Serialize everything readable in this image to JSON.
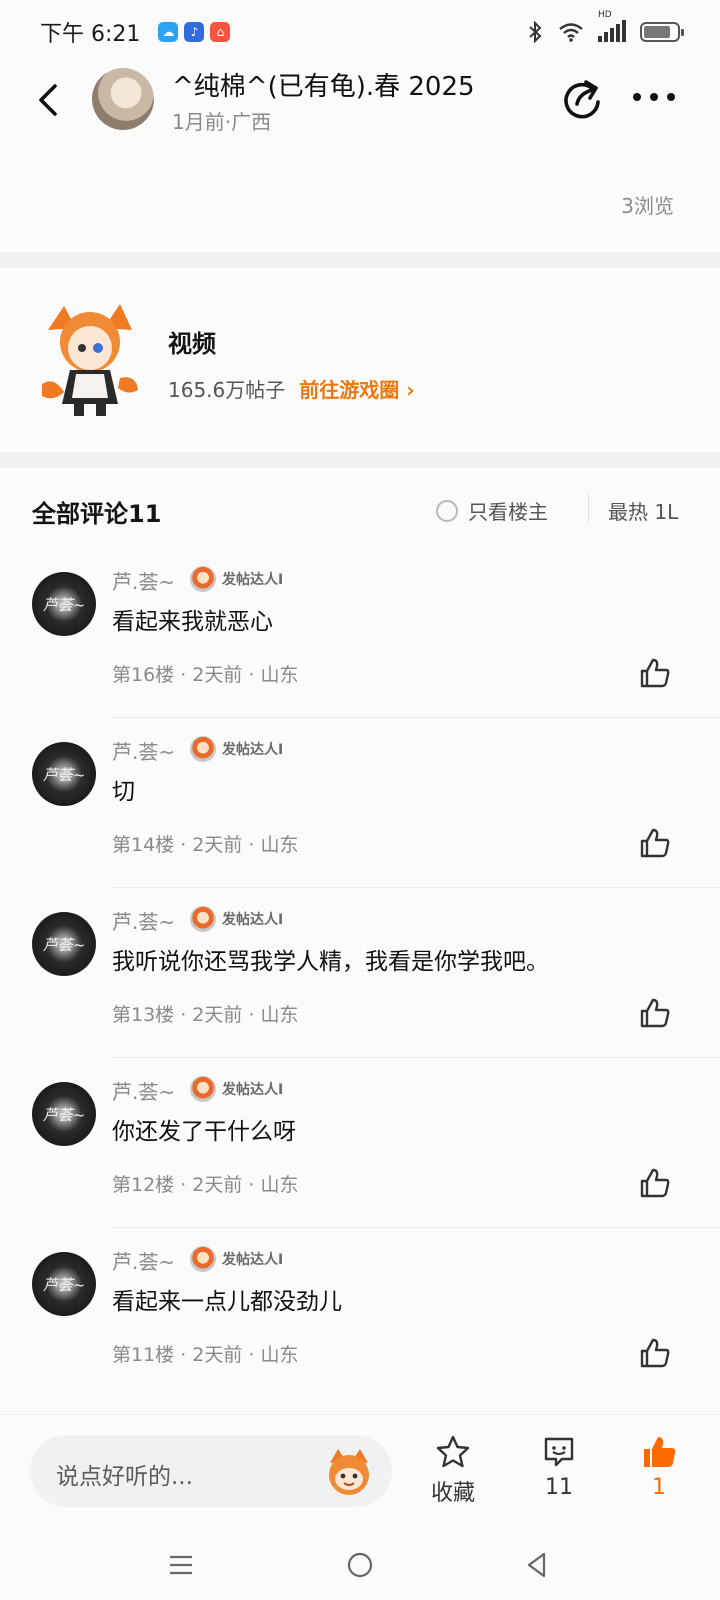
{
  "status_bar": {
    "time": "下午 6:21",
    "icons": [
      "weather-icon",
      "notification-icon",
      "home-app-icon"
    ],
    "right_icons": [
      "bluetooth-icon",
      "wifi-icon",
      "signal-icon",
      "battery-icon"
    ],
    "signal_label": "HD"
  },
  "header": {
    "author_name": "^纯棉^(已有龟).春 2025",
    "author_meta": "1月前·广西"
  },
  "post": {
    "views": "3浏览"
  },
  "circle": {
    "title": "视频",
    "posts_count": "165.6万帖子",
    "link_label": "前往游戏圈",
    "link_chevron": "›"
  },
  "comments_section": {
    "title": "全部评论11",
    "owner_only_label": "只看楼主",
    "sort_label": "最热 1L"
  },
  "comments": [
    {
      "avatar_text": "芦荟~",
      "name": "芦.荟~",
      "badge": "发帖达人I",
      "text": "看起来我就恶心",
      "meta": "第16楼 · 2天前 · 山东"
    },
    {
      "avatar_text": "芦荟~",
      "name": "芦.荟~",
      "badge": "发帖达人I",
      "text": "切",
      "meta": "第14楼 · 2天前 · 山东"
    },
    {
      "avatar_text": "芦荟~",
      "name": "芦.荟~",
      "badge": "发帖达人I",
      "text": "我听说你还骂我学人精，我看是你学我吧。",
      "meta": "第13楼 · 2天前 · 山东"
    },
    {
      "avatar_text": "芦荟~",
      "name": "芦.荟~",
      "badge": "发帖达人I",
      "text": "你还发了干什么呀",
      "meta": "第12楼 · 2天前 · 山东"
    },
    {
      "avatar_text": "芦荟~",
      "name": "芦.荟~",
      "badge": "发帖达人I",
      "text": "看起来一点儿都没劲儿",
      "meta": "第11楼 · 2天前 · 山东"
    }
  ],
  "bottom_bar": {
    "reply_placeholder": "说点好听的...",
    "favorite_label": "收藏",
    "comment_count": "11",
    "like_count": "1"
  },
  "colors": {
    "accent": "#f0770e",
    "like_active": "#ff6a00"
  }
}
